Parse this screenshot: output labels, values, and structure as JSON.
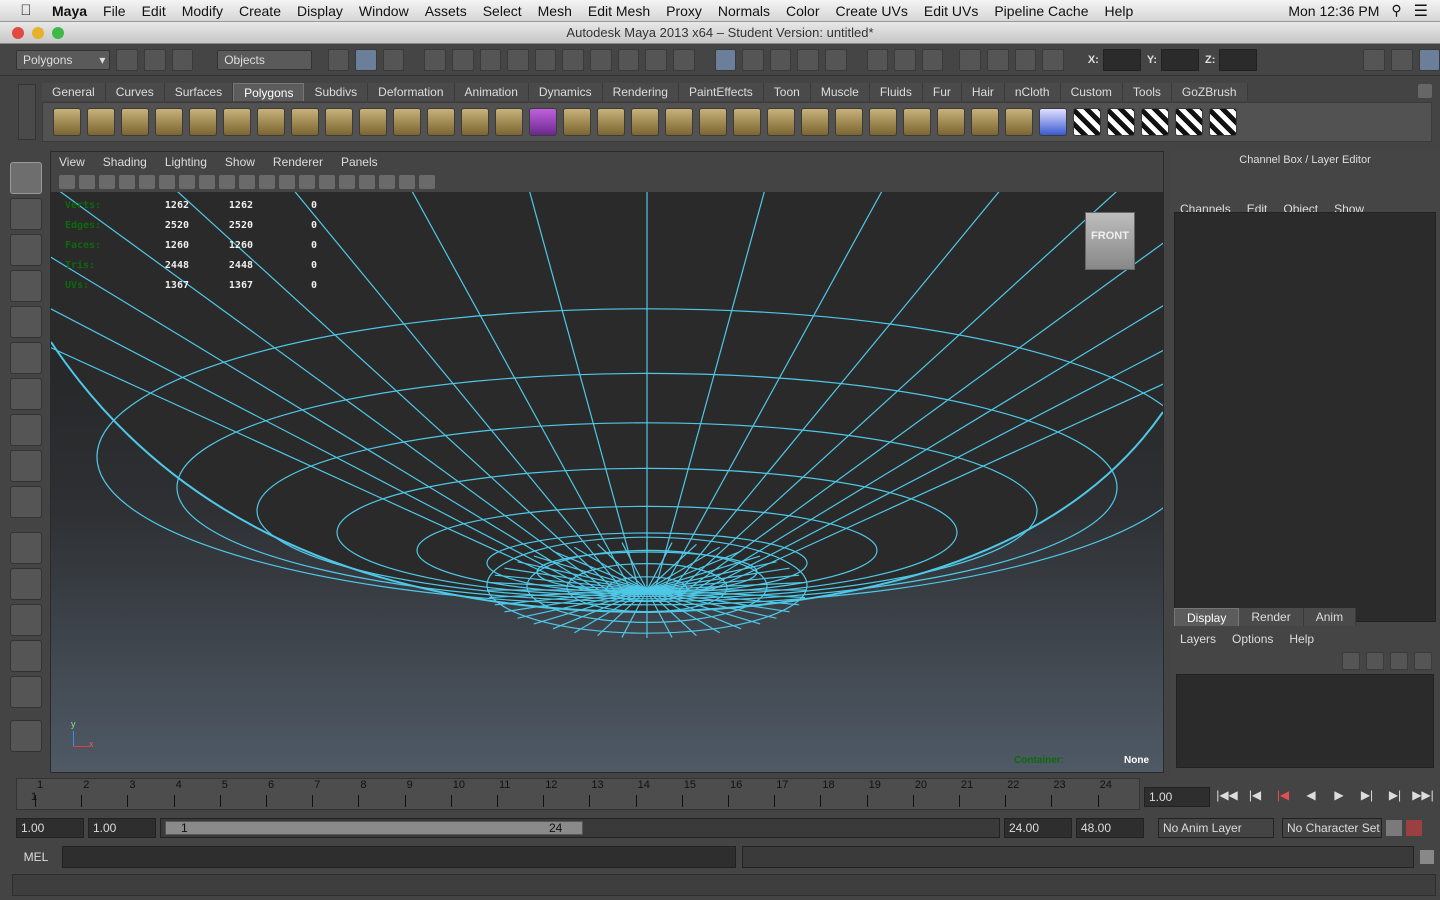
{
  "mac_menu": {
    "app": "Maya",
    "items": [
      "File",
      "Edit",
      "Modify",
      "Create",
      "Display",
      "Window",
      "Assets",
      "Select",
      "Mesh",
      "Edit Mesh",
      "Proxy",
      "Normals",
      "Color",
      "Create UVs",
      "Edit UVs",
      "Pipeline Cache",
      "Help"
    ],
    "clock": "Mon 12:36 PM"
  },
  "window_title": "Autodesk Maya 2013 x64 – Student Version: untitled*",
  "status_line": {
    "menuset": "Polygons",
    "selection_mode": "Objects",
    "x_label": "X:",
    "y_label": "Y:",
    "z_label": "Z:"
  },
  "shelf_tabs": [
    "General",
    "Curves",
    "Surfaces",
    "Polygons",
    "Subdivs",
    "Deformation",
    "Animation",
    "Dynamics",
    "Rendering",
    "PaintEffects",
    "Toon",
    "Muscle",
    "Fluids",
    "Fur",
    "Hair",
    "nCloth",
    "Custom",
    "Tools",
    "GoZBrush"
  ],
  "active_shelf": "Polygons",
  "viewport": {
    "menu": [
      "View",
      "Shading",
      "Lighting",
      "Show",
      "Renderer",
      "Panels"
    ],
    "hud": [
      {
        "label": "Verts:",
        "a": "1262",
        "b": "1262",
        "c": "0"
      },
      {
        "label": "Edges:",
        "a": "2520",
        "b": "2520",
        "c": "0"
      },
      {
        "label": "Faces:",
        "a": "1260",
        "b": "1260",
        "c": "0"
      },
      {
        "label": "Tris:",
        "a": "2448",
        "b": "2448",
        "c": "0"
      },
      {
        "label": "UVs:",
        "a": "1367",
        "b": "1367",
        "c": "0"
      }
    ],
    "view_cube": "FRONT",
    "container_label": "Container:",
    "container_value": "None",
    "axis_y": "y",
    "axis_x": "x",
    "wire_color": "#4fc8e8"
  },
  "channel_box": {
    "title": "Channel Box / Layer Editor",
    "menu": [
      "Channels",
      "Edit",
      "Object",
      "Show"
    ]
  },
  "layer_editor": {
    "tabs": [
      "Display",
      "Render",
      "Anim"
    ],
    "active_tab": "Display",
    "menu": [
      "Layers",
      "Options",
      "Help"
    ]
  },
  "timeline": {
    "ticks": [
      "1",
      "2",
      "3",
      "4",
      "5",
      "6",
      "7",
      "8",
      "9",
      "10",
      "11",
      "12",
      "13",
      "14",
      "15",
      "16",
      "17",
      "18",
      "19",
      "20",
      "21",
      "22",
      "23",
      "24"
    ],
    "current_frame": "1",
    "current_time": "1.00"
  },
  "range": {
    "start": "1.00",
    "playback_start": "1.00",
    "slider_start": "1",
    "slider_end": "24",
    "playback_end": "24.00",
    "end": "48.00",
    "anim_layer": "No Anim Layer",
    "character_set": "No Character Set"
  },
  "mel": {
    "label": "MEL"
  }
}
